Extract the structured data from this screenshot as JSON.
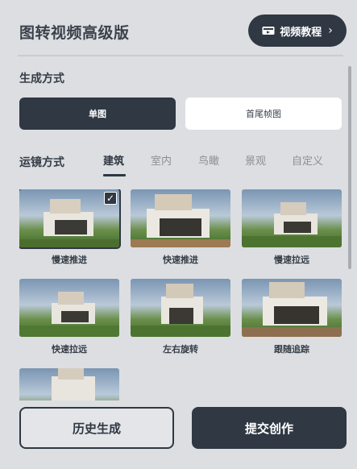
{
  "header": {
    "title": "图转视频高级版",
    "tutorial_label": "视频教程",
    "tutorial_icon": "video-camera-icon",
    "chevron_icon": "chevron-right-icon"
  },
  "generation": {
    "label": "生成方式",
    "options": [
      "单图",
      "首尾帧图"
    ],
    "selected": "单图"
  },
  "camera": {
    "label": "运镜方式",
    "tabs": [
      "建筑",
      "室内",
      "鸟瞰",
      "景观",
      "自定义"
    ],
    "active_tab": "建筑",
    "presets": [
      {
        "label": "慢速推进",
        "selected": true
      },
      {
        "label": "快速推进",
        "selected": false
      },
      {
        "label": "慢速拉远",
        "selected": false
      },
      {
        "label": "快速拉远",
        "selected": false
      },
      {
        "label": "左右旋转",
        "selected": false
      },
      {
        "label": "跟随追踪",
        "selected": false
      },
      {
        "label": "",
        "selected": false
      }
    ],
    "check_icon": "check-icon"
  },
  "footer": {
    "history_label": "历史生成",
    "submit_label": "提交创作"
  },
  "colors": {
    "background": "#dcdee1",
    "primary_dark": "#2f3843",
    "white": "#ffffff"
  }
}
